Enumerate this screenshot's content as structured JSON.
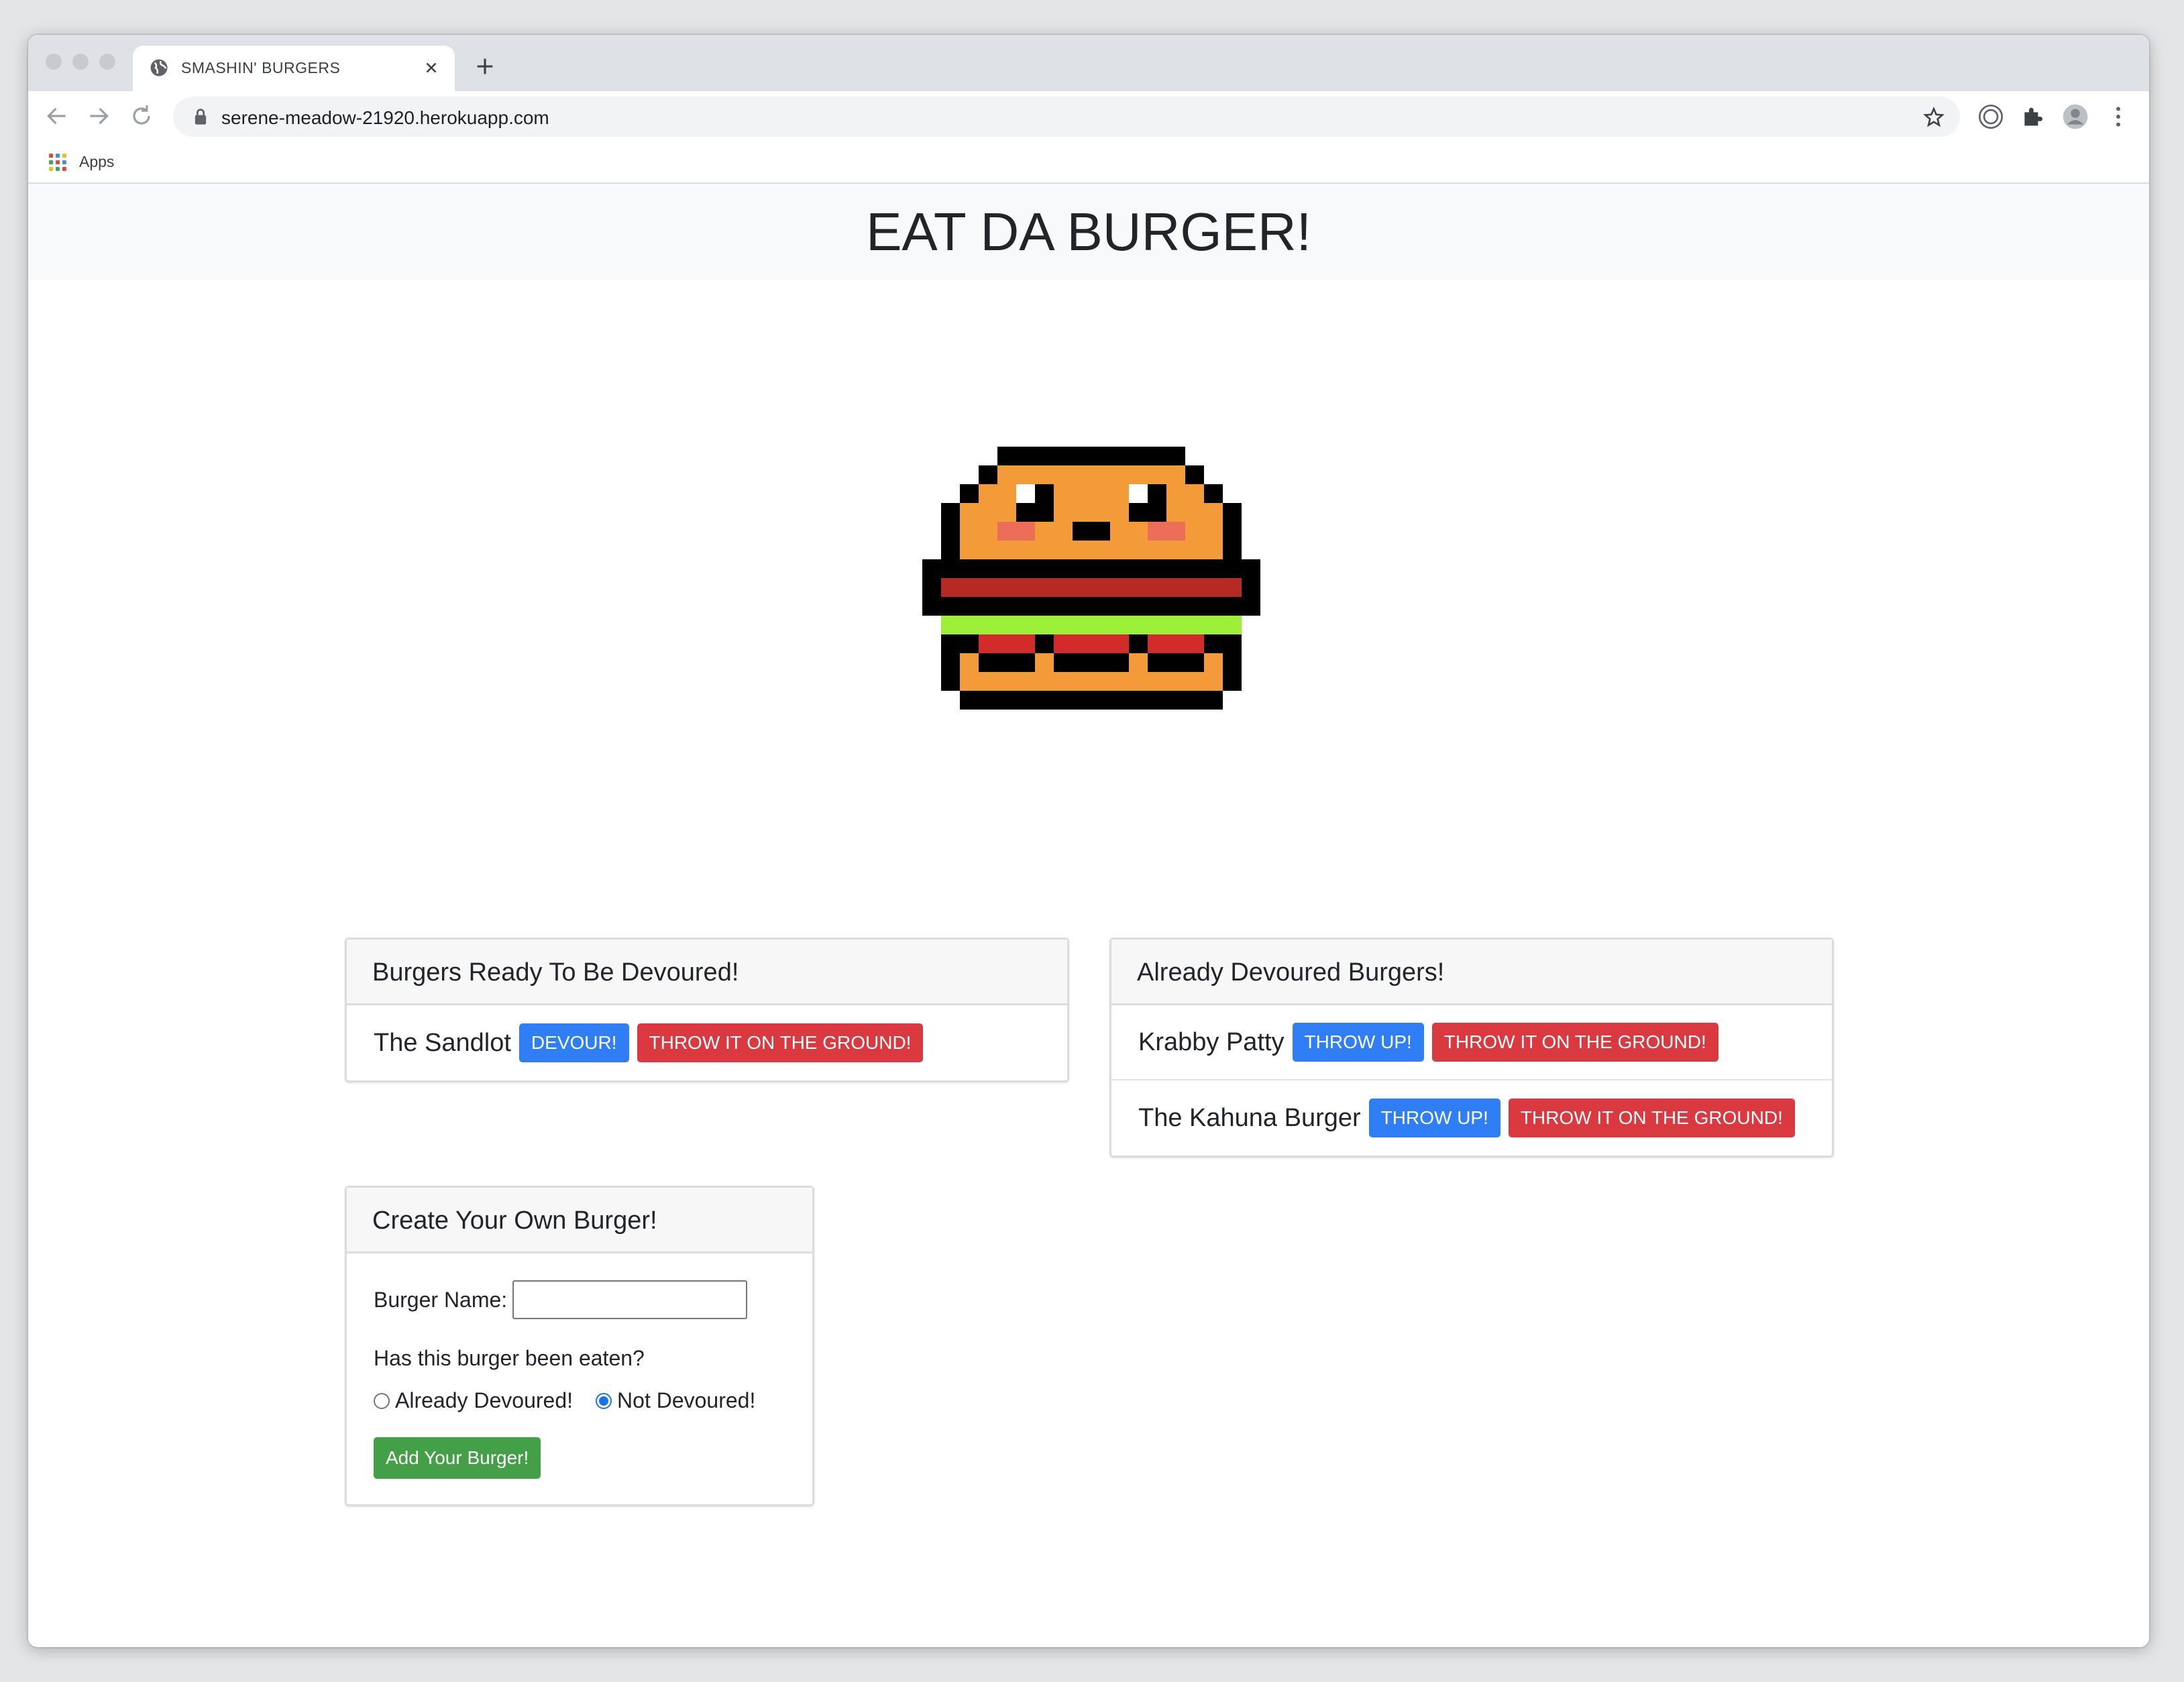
{
  "browser": {
    "tab_title": "SMASHIN' BURGERS",
    "url": "serene-meadow-21920.herokuapp.com",
    "bookmarks": {
      "apps_label": "Apps"
    }
  },
  "page": {
    "heading": "EAT DA BURGER!",
    "ready_card": {
      "title": "Burgers Ready To Be Devoured!",
      "items": [
        {
          "name": "The Sandlot",
          "action": "DEVOUR!",
          "delete": "THROW IT ON THE GROUND!"
        }
      ]
    },
    "devoured_card": {
      "title": "Already Devoured Burgers!",
      "items": [
        {
          "name": "Krabby Patty",
          "action": "THROW UP!",
          "delete": "THROW IT ON THE GROUND!"
        },
        {
          "name": "The Kahuna Burger",
          "action": "THROW UP!",
          "delete": "THROW IT ON THE GROUND!"
        }
      ]
    },
    "create_card": {
      "title": "Create Your Own Burger!",
      "name_label": "Burger Name:",
      "name_value": "",
      "question": "Has this burger been eaten?",
      "option_devoured": "Already Devoured!",
      "option_not_devoured": "Not Devoured!",
      "selected_option": "Not Devoured!",
      "submit_label": "Add Your Burger!"
    }
  },
  "colors": {
    "accent_blue": "#2f7ef6",
    "danger_red": "#d9393f",
    "success_green": "#43a047",
    "bun_orange": "#f29b38",
    "lettuce_green": "#9cf03a",
    "patty_red": "#b72a24"
  }
}
